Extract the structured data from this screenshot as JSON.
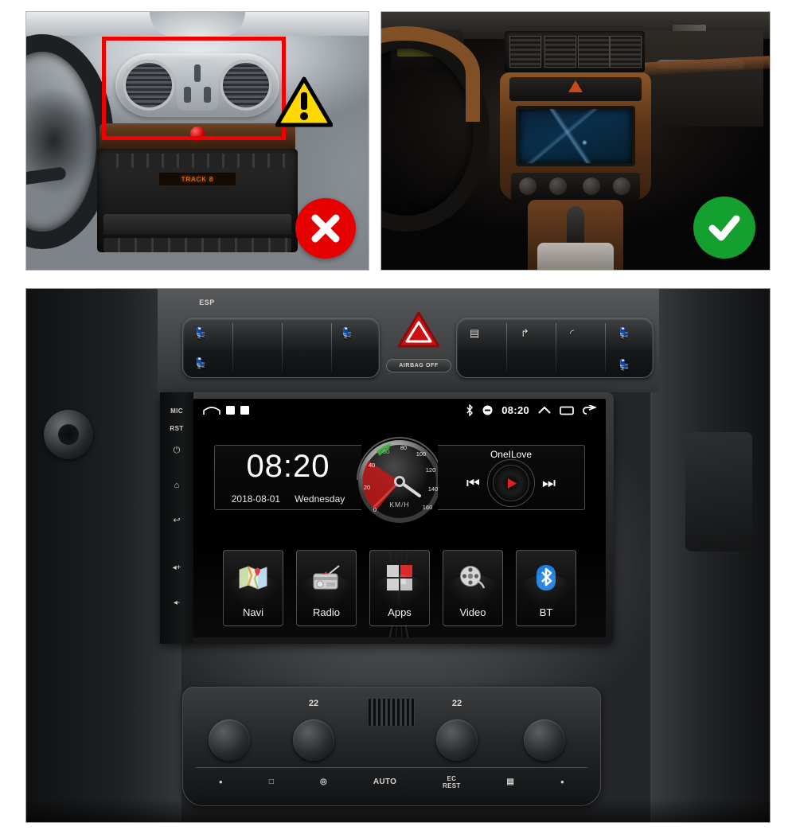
{
  "comparison": {
    "bad": {
      "label": "incorrect-fitment",
      "badge_icon": "x-mark-icon",
      "warning_icon": "warning-triangle-icon",
      "highlight_box": "red-highlight-box",
      "radio_display_text": "TRACK 8",
      "caption": ""
    },
    "good": {
      "label": "correct-fitment",
      "badge_icon": "check-mark-icon",
      "caption": ""
    }
  },
  "dashboard": {
    "esp_label": "ESP",
    "airbag_label": "AIRBAG OFF",
    "hazard_icon": "hazard-triangle-icon",
    "left_pod_icons": [
      "seat-heater-icon",
      "seat-heater-icon",
      "window-icon",
      "window-icon",
      "mirror-icon"
    ],
    "right_pod_icons": [
      "window-lock-icon",
      "child-lock-icon",
      "sunroof-icon",
      "seat-heater-icon"
    ]
  },
  "head_unit": {
    "side_buttons": [
      {
        "label": "MIC",
        "name": "mic-button",
        "type": "text"
      },
      {
        "label": "RST",
        "name": "reset-button",
        "type": "text"
      },
      {
        "label": "⏻",
        "name": "power-button",
        "type": "glyph"
      },
      {
        "label": "⌂",
        "name": "home-button",
        "type": "glyph"
      },
      {
        "label": "↩",
        "name": "back-button",
        "type": "glyph"
      },
      {
        "label": "◂+",
        "name": "volume-up-button",
        "type": "glyph"
      },
      {
        "label": "◂-",
        "name": "volume-down-button",
        "type": "glyph"
      }
    ],
    "status_bar": {
      "home_icon": "home-outline-icon",
      "notification_icons": [
        "play-chip-icon",
        "image-chip-icon"
      ],
      "bluetooth_icon": "bluetooth-icon",
      "dnd_icon": "do-not-disturb-icon",
      "time": "08:20",
      "expand_icon": "chevron-up-icon",
      "recents_icon": "recents-icon",
      "back_icon": "back-arrow-icon"
    },
    "clock_widget": {
      "time": "08:20",
      "date": "2018-08-01",
      "weekday": "Wednesday"
    },
    "gauge_widget": {
      "unit": "KM/H",
      "ticks": [
        "0",
        "20",
        "40",
        "60",
        "80",
        "100",
        "120",
        "140",
        "160"
      ],
      "value": 0
    },
    "media_widget": {
      "track": "OneILove",
      "prev_icon": "skip-previous-icon",
      "play_icon": "play-icon",
      "next_icon": "skip-next-icon"
    },
    "apps": [
      {
        "label": "Navi",
        "icon": "map-icon"
      },
      {
        "label": "Radio",
        "icon": "radio-icon"
      },
      {
        "label": "Apps",
        "icon": "grid-apps-icon"
      },
      {
        "label": "Video",
        "icon": "film-reel-icon"
      },
      {
        "label": "BT",
        "icon": "bluetooth-icon"
      }
    ]
  },
  "climate": {
    "temp_left": "22",
    "temp_right": "22",
    "buttons": [
      {
        "label": "●",
        "name": "indicator-dot"
      },
      {
        "label": "□",
        "name": "rear-defrost-button"
      },
      {
        "label": "◎",
        "name": "recirculation-button"
      },
      {
        "label": "AUTO",
        "name": "auto-button"
      },
      {
        "label": "EC\nREST",
        "name": "ec-rest-button"
      },
      {
        "label": "▤",
        "name": "front-defrost-button"
      },
      {
        "label": "●",
        "name": "indicator-dot"
      }
    ]
  },
  "colors": {
    "warning_yellow": "#ffd800",
    "error_red": "#e60000",
    "success_green": "#14a02e",
    "highlight_red": "#f00000",
    "accent_blue": "#2196f3"
  }
}
